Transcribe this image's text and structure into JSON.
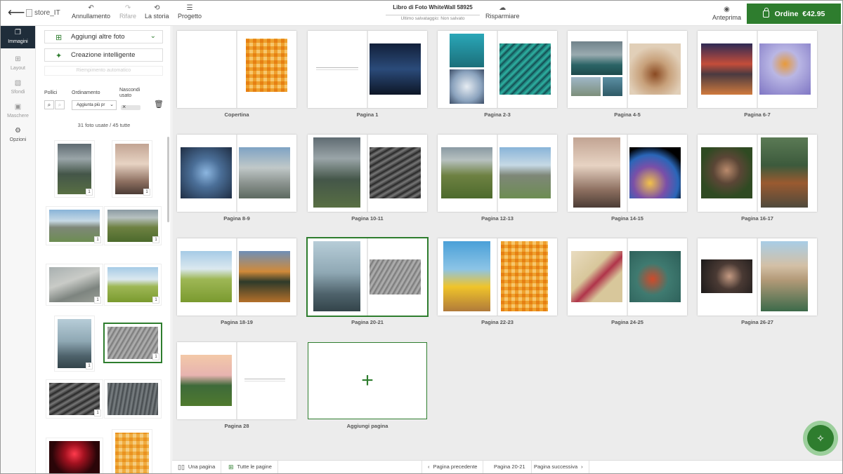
{
  "colors": {
    "accent": "#2e7d2e",
    "rail_active": "#1f2d3a",
    "canvas": "#ececec"
  },
  "header": {
    "back_icon": "arrow-left-icon",
    "logo_alt": "store_IT",
    "undo": "Annullamento",
    "redo": "Rifare",
    "history": "La storia",
    "project": "Progetto",
    "doc_title": "Libro di Foto WhiteWall 58925",
    "doc_status": "Ultimo salvataggio: Non salvato",
    "save": "Risparmiare",
    "preview": "Anteprima",
    "order": "Ordine  €42.95"
  },
  "rail": [
    {
      "label": "Immagini",
      "icon": "images-icon"
    },
    {
      "label": "Layout",
      "icon": "layout-icon"
    },
    {
      "label": "Sfondi",
      "icon": "backgrounds-icon"
    },
    {
      "label": "Maschere",
      "icon": "masks-icon"
    },
    {
      "label": "Opzioni",
      "icon": "gear-icon"
    }
  ],
  "panel": {
    "add_photos": "Aggiungi altre foto",
    "smart_creation": "Creazione intelligente",
    "smart_fill": "Riempimento automatico",
    "thumbs_label": "Pollici",
    "sort_label": "Ordinamento",
    "sort_value": "Aggiunta più pr",
    "hide_used_1": "Nascondi",
    "hide_used_2": "usato",
    "photo_count": "31 foto usate / 45 tutte",
    "badge": "1"
  },
  "pages": [
    "Copertina",
    "Pagina 1",
    "Pagina 2-3",
    "Pagina 4-5",
    "Pagina 6-7",
    "Pagina 8-9",
    "Pagina 10-11",
    "Pagina 12-13",
    "Pagina 14-15",
    "Pagina 16-17",
    "Pagina 18-19",
    "Pagina 20-21",
    "Pagina 22-23",
    "Pagina 24-25",
    "Pagina 26-27",
    "Pagina 28"
  ],
  "add_page": "Aggiungi pagina",
  "add_symbol": "+",
  "bottom": {
    "single_page": "Una pagina",
    "all_pages": "Tutte le pagine",
    "prev": "Pagina precedente",
    "current": "Pagina 20-21",
    "next": "Pagina successiva"
  }
}
